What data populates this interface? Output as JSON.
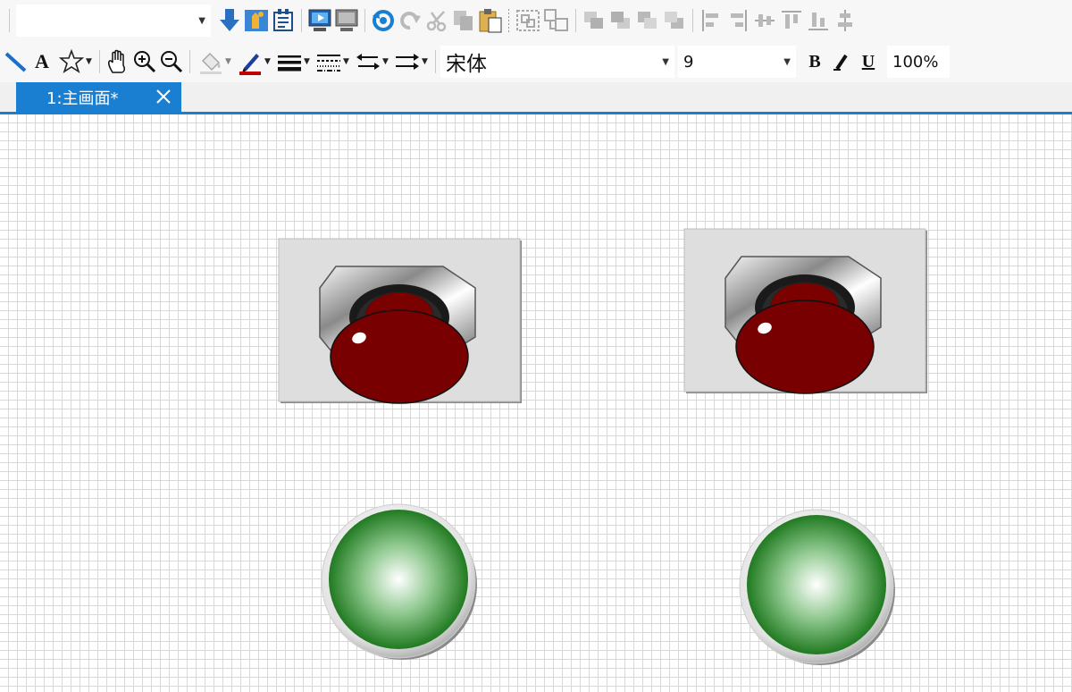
{
  "toolbar1": {
    "object_combo_value": "",
    "icons": [
      "download-icon",
      "upload-icon",
      "compile-icon",
      "online-simulation-icon",
      "offline-simulation-icon",
      "undo-icon",
      "redo-icon",
      "cut-icon",
      "copy-icon",
      "paste-icon",
      "group-icon",
      "ungroup-icon",
      "bring-front-icon",
      "send-back-icon",
      "bring-forward-icon",
      "send-backward-icon",
      "align-left-icon",
      "align-right-icon",
      "align-hcenter-icon",
      "align-top-icon",
      "align-bottom-icon",
      "align-vcenter-icon"
    ]
  },
  "toolbar2": {
    "text_tool_label": "A",
    "font_name": "宋体",
    "font_size": "9",
    "bold_label": "B",
    "underline_label": "U",
    "zoom": "100%"
  },
  "tabs": [
    {
      "label": "1:主画面*",
      "active": true
    }
  ],
  "colors": {
    "accent": "#1b7fd1",
    "button_red": "#780000",
    "lamp_green": "#0b6b0b",
    "panel_gray": "#dedede"
  },
  "canvas_widgets": [
    {
      "type": "red-mushroom-push-button"
    },
    {
      "type": "red-mushroom-push-button"
    },
    {
      "type": "green-indicator-lamp"
    },
    {
      "type": "green-indicator-lamp"
    }
  ]
}
